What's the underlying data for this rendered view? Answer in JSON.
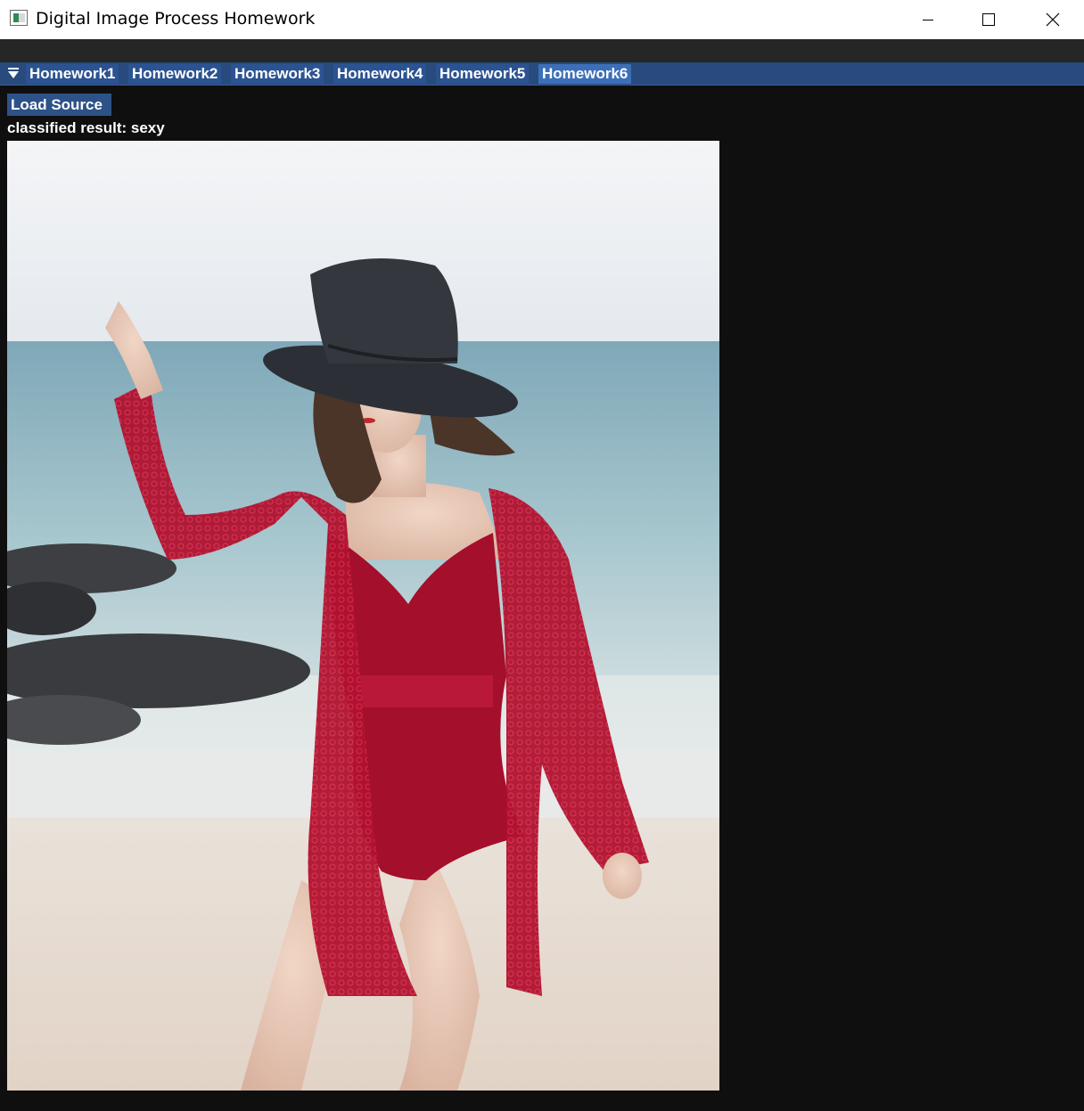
{
  "window": {
    "title": "Digital Image Process Homework",
    "app_icon": "image-app-icon"
  },
  "window_controls": {
    "minimize_icon": "minimize-icon",
    "maximize_icon": "maximize-icon",
    "close_icon": "close-icon"
  },
  "tabbar": {
    "collapse_icon": "triangle-down-icon",
    "tabs": [
      {
        "label": "Homework1"
      },
      {
        "label": "Homework2"
      },
      {
        "label": "Homework3"
      },
      {
        "label": "Homework4"
      },
      {
        "label": "Homework5"
      },
      {
        "label": "Homework6"
      }
    ],
    "active_tab": "Homework6"
  },
  "panel": {
    "load_button_label": "Load Source",
    "result_text": "classified result: sexy"
  },
  "colors": {
    "window_bg": "#0f0f0f",
    "tabbar_bg": "#284a7d",
    "tab_bg": "#2c5391",
    "tab_active_bg": "#3d6fb8",
    "button_bg": "#2d5287",
    "text": "#ffffff"
  }
}
